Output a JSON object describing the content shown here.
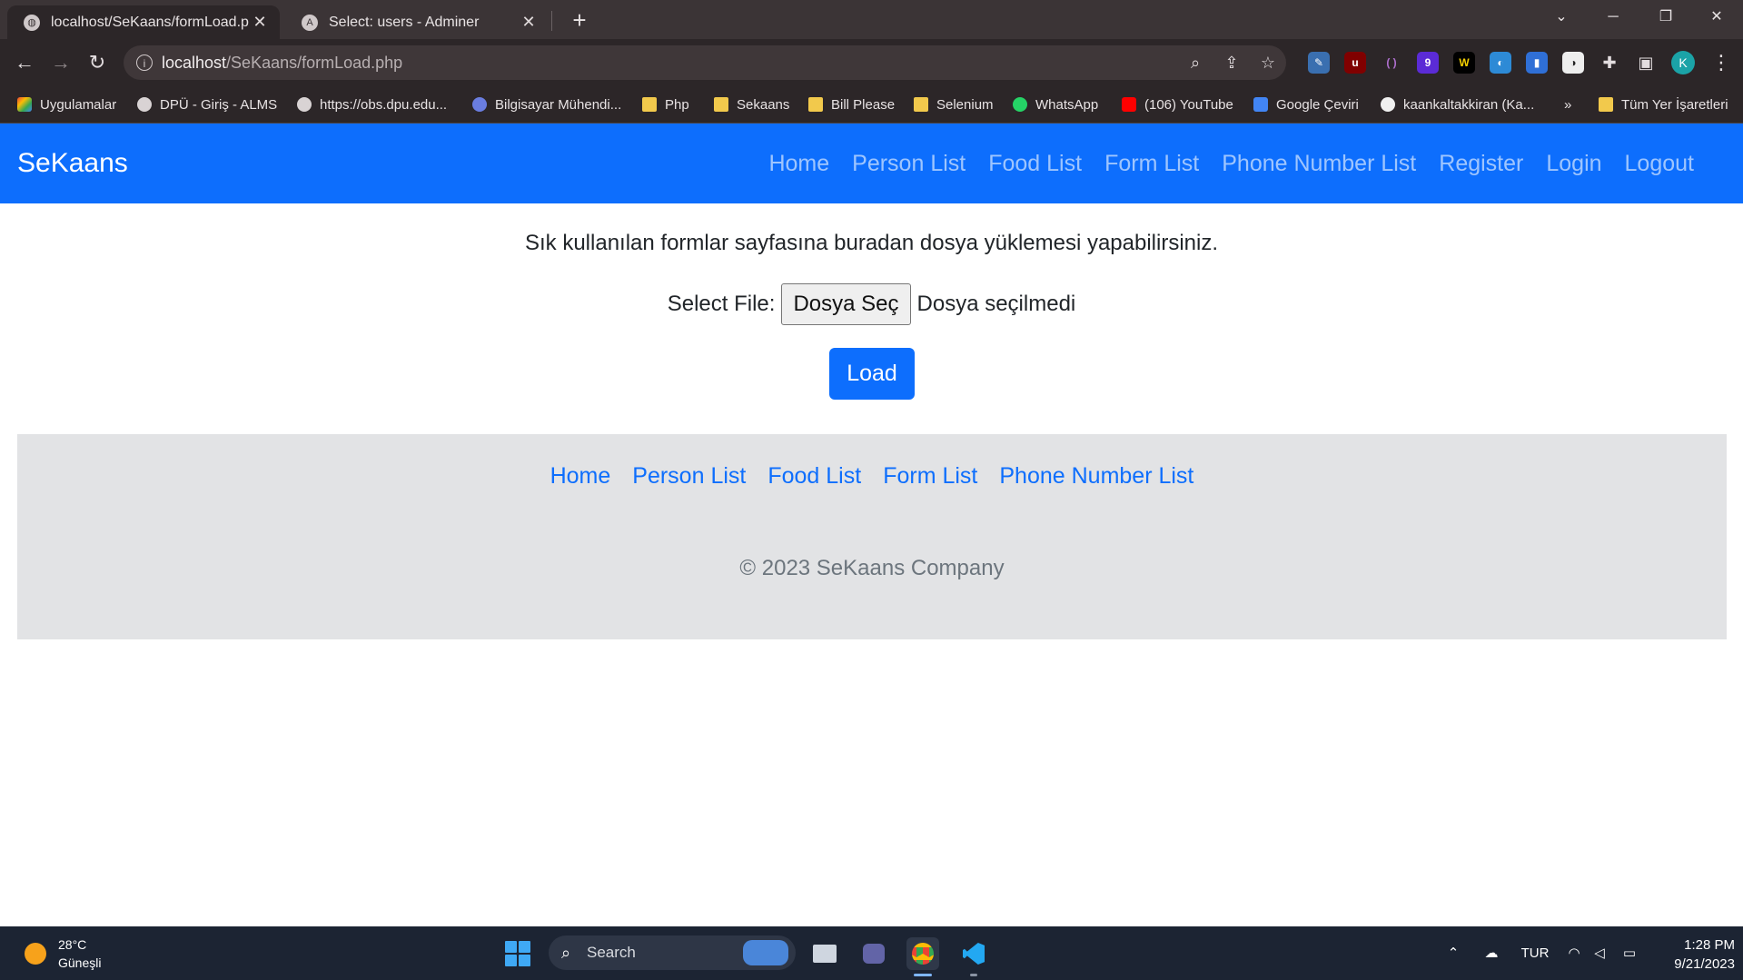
{
  "browser": {
    "tabs": [
      {
        "title": "localhost/SeKaans/formLoad.php",
        "active": true
      },
      {
        "title": "Select: users - Adminer",
        "active": false
      }
    ],
    "address": {
      "host": "localhost",
      "path": "/SeKaans/formLoad.php"
    },
    "bookmarks": [
      "Uygulamalar",
      "DPÜ - Giriş - ALMS",
      "https://obs.dpu.edu...",
      "Bilgisayar Mühendi...",
      "Php",
      "Sekaans",
      "Bill Please",
      "Selenium",
      "WhatsApp",
      "(106) YouTube",
      "Google Çeviri",
      "kaankaltakkiran (Ka...",
      "»",
      "Tüm Yer İşaretleri"
    ],
    "profile_initial": "K",
    "extension_badge": "9"
  },
  "site": {
    "brand": "SeKaans",
    "nav": [
      "Home",
      "Person List",
      "Food List",
      "Form List",
      "Phone Number List",
      "Register",
      "Login",
      "Logout"
    ],
    "lead_text": "Sık kullanılan formlar sayfasına buradan dosya yüklemesi yapabilirsiniz.",
    "file_label": "Select File:",
    "file_button": "Dosya Seç",
    "file_status": "Dosya seçilmedi",
    "submit_label": "Load",
    "footer_links": [
      "Home",
      "Person List",
      "Food List",
      "Form List",
      "Phone Number List"
    ],
    "copyright": "© 2023 SeKaans Company",
    "colors": {
      "primary": "#0d6efd",
      "footer_bg": "#e2e3e5"
    }
  },
  "taskbar": {
    "weather_temp": "28°C",
    "weather_desc": "Güneşli",
    "search_label": "Search",
    "language": "TUR",
    "time": "1:28 PM",
    "date": "9/21/2023"
  }
}
